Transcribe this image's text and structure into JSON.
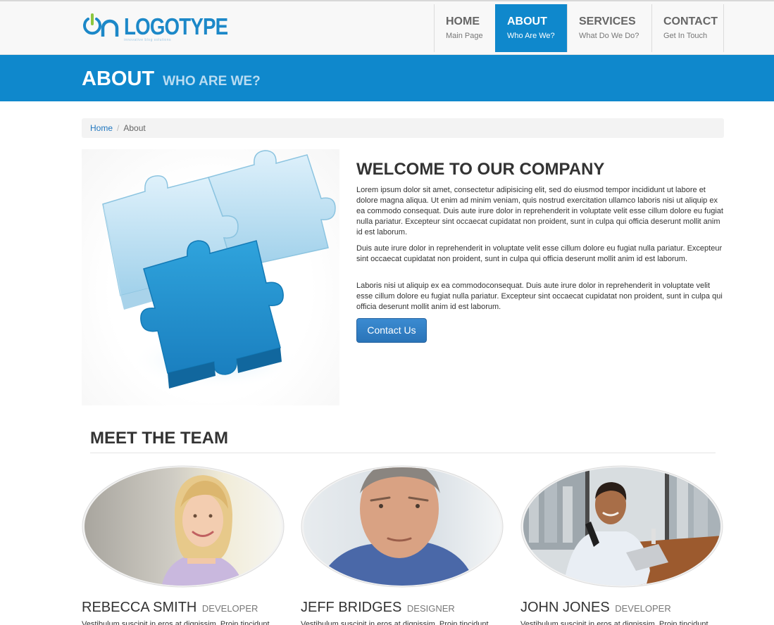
{
  "header": {
    "logo_text": "LOGOTYPE",
    "logo_tagline": "innovative blog solutions",
    "nav": [
      {
        "title": "HOME",
        "sub": "Main Page"
      },
      {
        "title": "ABOUT",
        "sub": "Who Are We?"
      },
      {
        "title": "SERVICES",
        "sub": "What Do We Do?"
      },
      {
        "title": "CONTACT",
        "sub": "Get In Touch"
      }
    ]
  },
  "banner": {
    "title": "ABOUT",
    "subtitle": "WHO ARE WE?"
  },
  "breadcrumb": {
    "home": "Home",
    "separator": "/",
    "current": "About"
  },
  "welcome": {
    "title": "WELCOME TO OUR COMPANY",
    "paragraphs": [
      "Lorem ipsum dolor sit amet, consectetur adipisicing elit, sed do eiusmod tempor incididunt ut labore et dolore magna aliqua. Ut enim ad minim veniam, quis nostrud exercitation ullamco laboris nisi ut aliquip ex ea commodo consequat. Duis aute irure dolor in reprehenderit in voluptate velit esse cillum dolore eu fugiat nulla pariatur. Excepteur sint occaecat cupidatat non proident, sunt in culpa qui officia deserunt mollit anim id est laborum.",
      "Duis aute irure dolor in reprehenderit in voluptate velit esse cillum dolore eu fugiat nulla pariatur. Excepteur sint occaecat cupidatat non proident, sunt in culpa qui officia deserunt mollit anim id est laborum.",
      "Laboris nisi ut aliquip ex ea commodoconsequat. Duis aute irure dolor in reprehenderit in voluptate velit esse cillum dolore eu fugiat nulla pariatur. Excepteur sint occaecat cupidatat non proident, sunt in culpa qui officia deserunt mollit anim id est laborum."
    ],
    "button": "Contact Us"
  },
  "team": {
    "title": "MEET THE TEAM",
    "members": [
      {
        "name": "REBECCA SMITH",
        "role": "DEVELOPER",
        "text": "Vestibulum suscipit in eros at dignissim. Proin tincidunt"
      },
      {
        "name": "JEFF BRIDGES",
        "role": "DESIGNER",
        "text": "Vestibulum suscipit in eros at dignissim. Proin tincidunt"
      },
      {
        "name": "JOHN JONES",
        "role": "DEVELOPER",
        "text": "Vestibulum suscipit in eros at dignissim. Proin tincidunt"
      }
    ]
  },
  "colors": {
    "brand_blue": "#0f88cc",
    "button_blue": "#2f7fc4",
    "link_blue": "#1f76bf",
    "logo_green": "#8cc63f"
  },
  "icons": {
    "logo_mark": "power-toggle-icon",
    "breadcrumb_separator": "slash"
  }
}
